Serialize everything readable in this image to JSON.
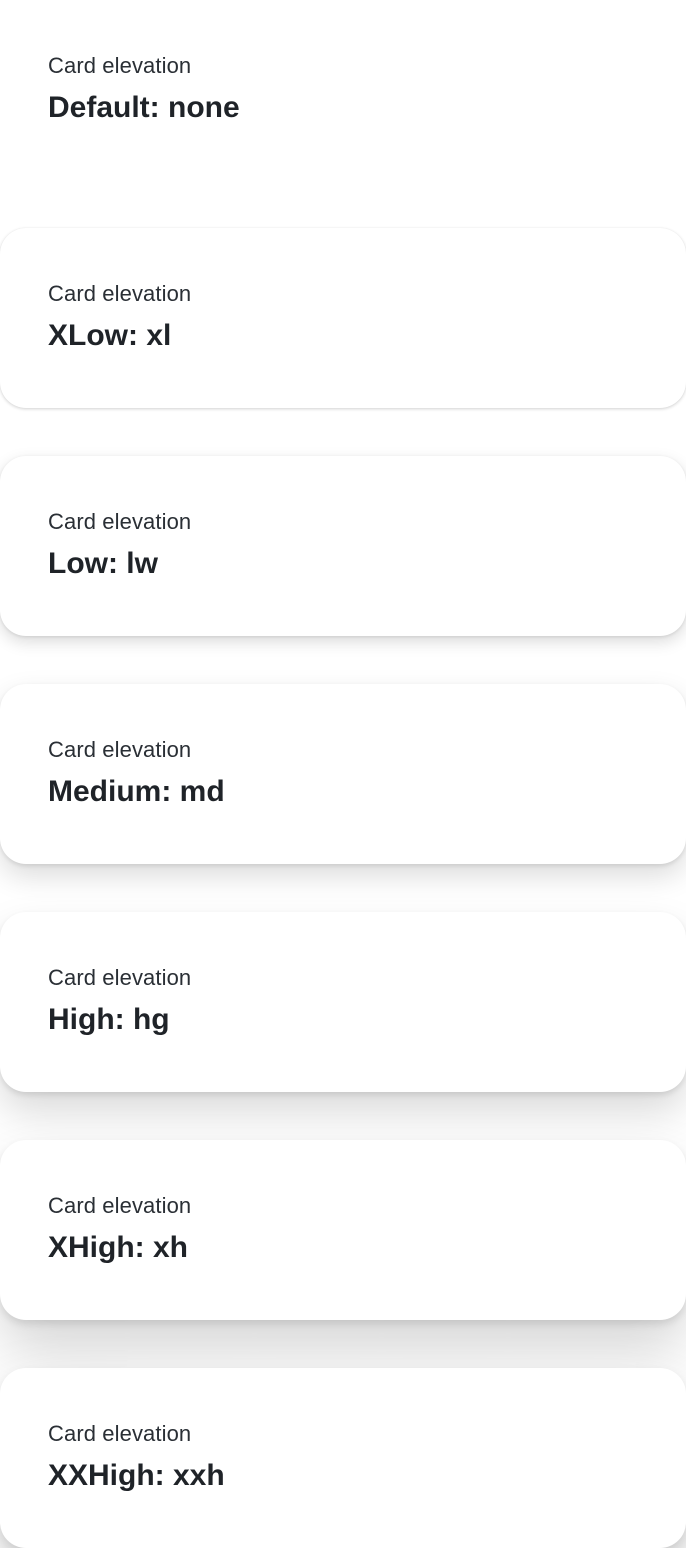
{
  "cards": [
    {
      "eyebrow": "Card elevation",
      "title": "Default: none"
    },
    {
      "eyebrow": "Card elevation",
      "title": "XLow: xl"
    },
    {
      "eyebrow": "Card elevation",
      "title": "Low: lw"
    },
    {
      "eyebrow": "Card elevation",
      "title": "Medium: md"
    },
    {
      "eyebrow": "Card elevation",
      "title": "High: hg"
    },
    {
      "eyebrow": "Card elevation",
      "title": "XHigh: xh"
    },
    {
      "eyebrow": "Card elevation",
      "title": "XXHigh: xxh"
    }
  ]
}
